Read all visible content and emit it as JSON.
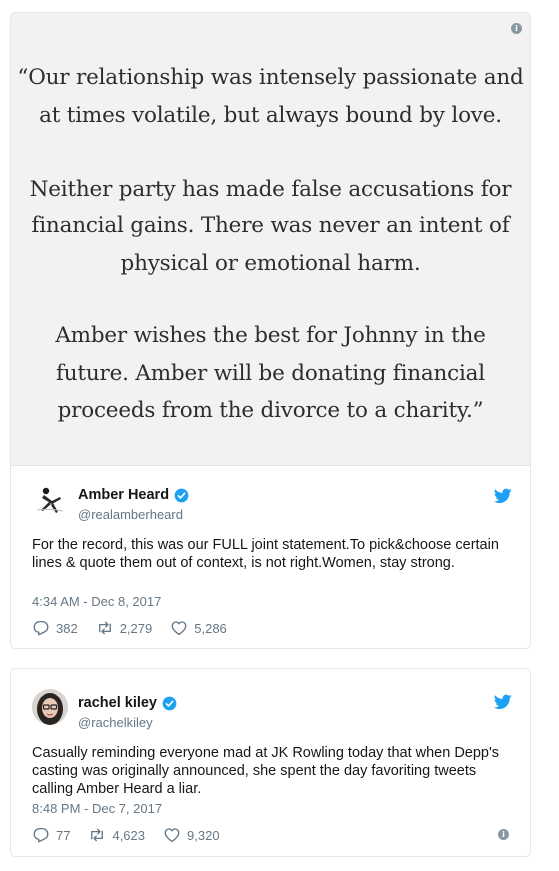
{
  "tweet1": {
    "media_quote": {
      "p1_l1": "“Our relationship was intensely passionate and",
      "p1_l2": "at times volatile, but always bound by love.",
      "p2_l1": "Neither party has made false accusations for",
      "p2_l2": "financial gains. There was never an intent of",
      "p2_l3": "physical or emotional harm.",
      "p3_l1": "Amber wishes the best for Johnny in the",
      "p3_l2": "future. Amber will be donating financial",
      "p3_l3": "proceeds from the divorce to a charity.”"
    },
    "name": "Amber Heard",
    "handle": "@realamberheard",
    "text": "For the record, this was our FULL joint statement.To pick&choose certain lines & quote them out of context, is not right.Women, stay strong.",
    "timestamp": "4:34 AM - Dec 8, 2017",
    "replies": "382",
    "retweets": "2,279",
    "likes": "5,286"
  },
  "tweet2": {
    "name": "rachel kiley",
    "handle": "@rachelkiley",
    "text": "Casually reminding everyone mad at JK Rowling today that when Depp's casting was originally announced, she spent the day favoriting tweets calling Amber Heard a liar.",
    "timestamp": "8:48 PM - Dec 7, 2017",
    "replies": "77",
    "retweets": "4,623",
    "likes": "9,320"
  },
  "icons": {
    "info": "info-icon",
    "verified": "verified-badge-icon",
    "twitter": "twitter-bird-icon",
    "reply": "reply-icon",
    "retweet": "retweet-icon",
    "like": "heart-icon"
  },
  "colors": {
    "twitter_blue": "#1da1f2",
    "muted_text": "#657786",
    "border": "#e1e8ed",
    "media_bg": "#f2f2f2"
  }
}
